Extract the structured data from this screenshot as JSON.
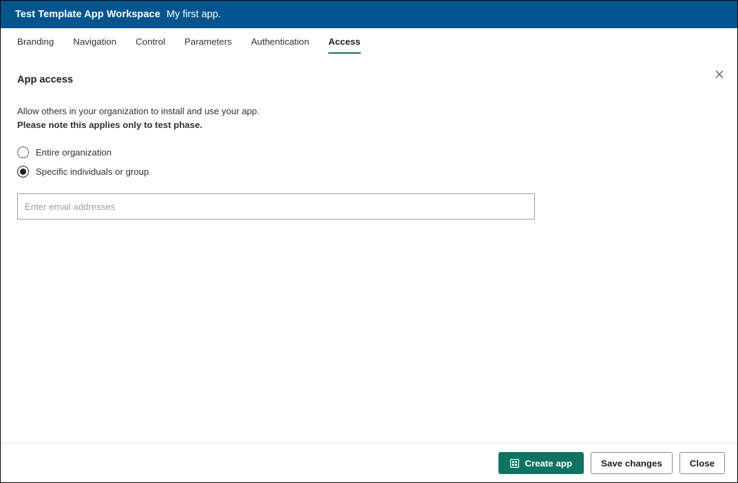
{
  "header": {
    "workspace_name": "Test Template App Workspace",
    "app_name": "My first app.",
    "background_color": "#04548f"
  },
  "tabs": [
    {
      "label": "Branding",
      "active": false
    },
    {
      "label": "Navigation",
      "active": false
    },
    {
      "label": "Control",
      "active": false
    },
    {
      "label": "Parameters",
      "active": false
    },
    {
      "label": "Authentication",
      "active": false
    },
    {
      "label": "Access",
      "active": true
    }
  ],
  "close_icon": "close-icon",
  "main": {
    "section_title": "App access",
    "description": "Allow others in your organization to install and use your app.",
    "description_note": "Please note this applies only to test phase.",
    "radio_options": [
      {
        "label": "Entire organization",
        "selected": false
      },
      {
        "label": "Specific individuals or group",
        "selected": true
      }
    ],
    "email_field": {
      "placeholder": "Enter email addresses",
      "value": ""
    }
  },
  "footer": {
    "create_label": "Create app",
    "create_icon": "app-grid-icon",
    "save_label": "Save changes",
    "close_label": "Close",
    "accent_color": "#107360",
    "divider_color": "#ebebeb"
  }
}
